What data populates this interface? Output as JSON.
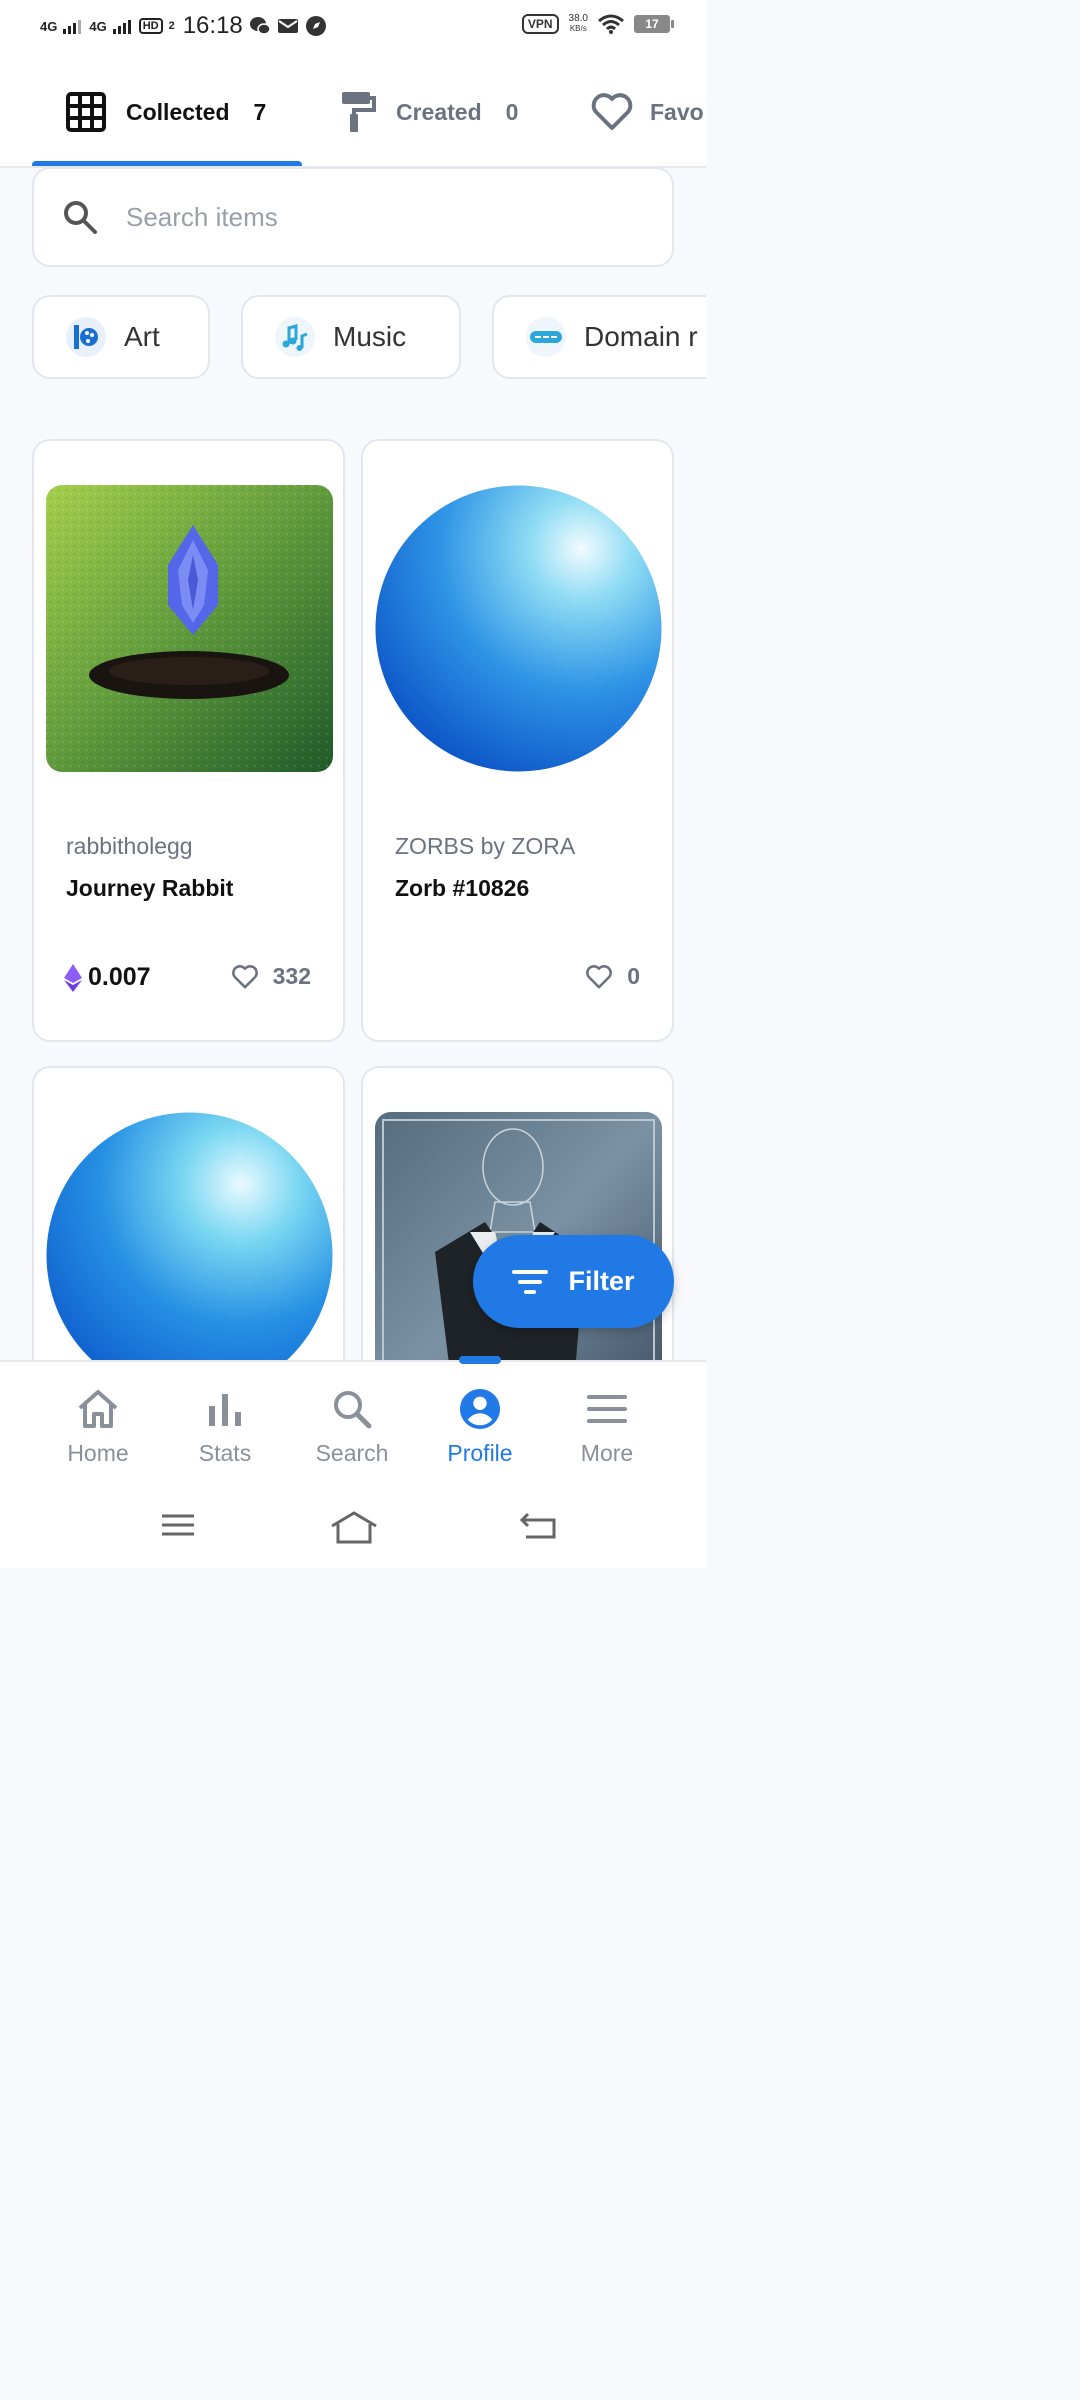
{
  "status_bar": {
    "signal_1": "4G",
    "signal_2": "4G",
    "hd": "HD",
    "hd_sub": "2",
    "time": "16:18",
    "vpn": "VPN",
    "speed_value": "38.0",
    "speed_unit": "KB/s",
    "battery": "17"
  },
  "tabs": [
    {
      "label": "Collected",
      "count": "7",
      "icon": "grid-icon",
      "active": true
    },
    {
      "label": "Created",
      "count": "0",
      "icon": "paint-roller-icon",
      "active": false
    },
    {
      "label": "Favo",
      "icon": "heart-icon",
      "active": false
    }
  ],
  "search": {
    "placeholder": "Search items"
  },
  "categories": [
    {
      "label": "Art",
      "icon": "art-icon"
    },
    {
      "label": "Music",
      "icon": "music-icon"
    },
    {
      "label": "Domain r",
      "icon": "domain-icon"
    }
  ],
  "cards": [
    {
      "collection": "rabbitholegg",
      "name": "Journey Rabbit",
      "price": "0.007",
      "likes": "332"
    },
    {
      "collection": "ZORBS by ZORA",
      "name": "Zorb #10826",
      "likes": "0"
    }
  ],
  "filter": {
    "label": "Filter"
  },
  "bottom_nav": [
    {
      "label": "Home",
      "icon": "home-icon"
    },
    {
      "label": "Stats",
      "icon": "bar-chart-icon"
    },
    {
      "label": "Search",
      "icon": "search-icon"
    },
    {
      "label": "Profile",
      "icon": "profile-icon",
      "active": true
    },
    {
      "label": "More",
      "icon": "menu-icon"
    }
  ],
  "colors": {
    "accent": "#2079e4",
    "text_muted": "#6b7280",
    "background": "#f7f9fc"
  }
}
